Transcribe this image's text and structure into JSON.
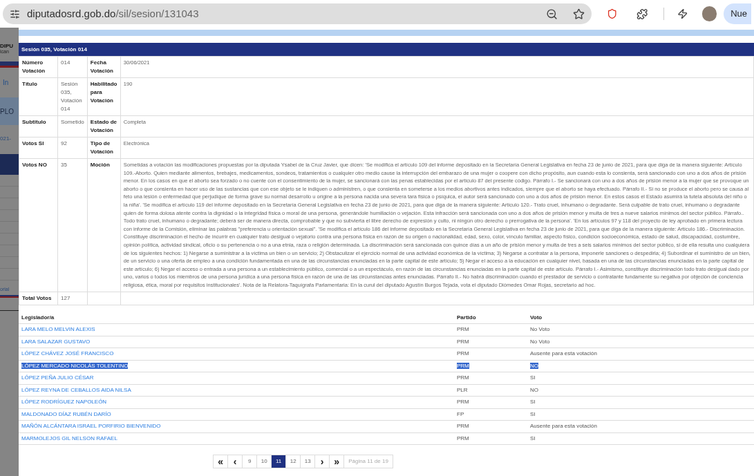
{
  "browser": {
    "url_host": "diputadosrd.gob.do",
    "url_path": "/sil/sesion/131043",
    "profile_button": "Nue"
  },
  "background_fragments": [
    "DIPU",
    "ican",
    "In",
    "PLO",
    "021-",
    "orial"
  ],
  "session": {
    "title": "Sesión 035, Votación 014",
    "rows": [
      {
        "label": "Número Votación",
        "value": "014",
        "label2": "Fecha Votación",
        "value2": "30/06/2021"
      },
      {
        "label": "Título",
        "value": "Sesión 035, Votación 014",
        "label2": "Habilitado para Votación",
        "value2": "190"
      },
      {
        "label": "Subtitulo",
        "value": "Sometido",
        "label2": "Estado de Votación",
        "value2": "Completa"
      },
      {
        "label": "Votos SI",
        "value": "92",
        "label2": "Tipo de Votación",
        "value2": "Electrónica"
      },
      {
        "label": "Votos NO",
        "value": "35",
        "label2": "Moción",
        "value2": "Sometidas a votación las modificaciones propuestas por la diputada Ysabel de la Cruz Javier, que dicen: 'Se modifica el artículo 109 del informe depositado en la Secretaría General Legislativa en fecha 23 de junio de 2021, para que diga de la manera siguiente: Artículo 109.-Aborto. Quien mediante alimentos, brebajes, medicamentos, sondeos, tratamientos o cualquier otro medio cause la interrupción del embarazo de una mujer o coopere con dicho propósito, aun cuando esta lo consienta, será sancionado con uno a dos años de prisión menor. En los casos en que el aborto sea forzado o no cuente con el consentimiento de la mujer, se sancionará con las penas establecidas por el artículo 87 del presente código. Párrafo I.- Se sancionará con uno a dos años de prisión menor a la mujer que se provoque un aborto o que consienta en hacer uso de las sustancias que con ese objeto se le indiquen o administren, o que consienta en someterse a los medios abortivos antes indicados, siempre que el aborto se haya efectuado. Párrafo II.- Si no se produce el aborto pero se causa al feto una lesión o enfermedad que perjudique de forma grave su normal desarrollo u origine a la persona nacida una severa tara física o psíquica, el autor será sancionado con uno a dos años de prisión menor. En estos casos el Estado asumirá la tutela absoluta del niño o la niña'. 'Se modifica el artículo 119 del informe depositado en la Secretaría General Legislativa en fecha 23 de junio de 2021, para que diga de la manera siguiente: Artículo 120.- Trato cruel, inhumano o degradante. Será culpable de trato cruel, inhumano o degradante quien de forma dolosa atente contra la dignidad o la integridad física o moral de una persona, generándole humillación o vejación. Esta infracción será sancionada con uno a dos años de prisión menor y multa de tres a nueve salarios mínimos del sector público. Párrafo.. Todo trato cruel, inhumano o degradante; deberá ser de manera directa, comprobable y que no subvierta el libre derecho de expresión y culto, ni ningún otro derecho o prerrogativa de la persona'. 'En los artículos 97 y 118 del proyecto de ley aprobado en primera lectura con informe de la Comisión, eliminar las palabras \"preferencia u orientación sexual\". 'Se modifica el artículo 186 del informe depositado en la Secretaría General Legislativa en fecha 23 de junio de 2021, para que diga de la manera siguiente: Artículo 186.- Discriminación. Constituye discriminación el hecho de incurrir en cualquier trato desigual o vejatorio contra una persona física en razón de su origen o nacionalidad, edad, sexo, color, vínculo familiar, aspecto físico, condición socioeconómica, estado de salud, discapacidad, costumbre, opinión política, actividad sindical, oficio o su pertenencia o no a una etnia, raza o religión determinada. La discriminación será sancionada con quince días a un año de prisión menor y multa de tres a seis salarios mínimos del sector público, si de ella resulta uno cualquiera de los siguientes hechos: 1) Negarse a suministrar a la víctima un bien o un servicio; 2) Obstaculizar el ejercicio normal de una actividad económica de la víctima; 3) Negarse a contratar a la persona, imponerle sanciones o despedirla; 4) Subordinar el suministro de un bien, de un servicio o una oferta de empleo a una condición fundamentada en una de las circunstancias enunciadas en la parte capital de este artículo; 5) Negar el acceso a la educación en cualquier nivel, basada en una de las circunstancias enunciadas en la parte capital de este artículo; 6) Negar el acceso o entrada a una persona a un establecimiento público, comercial o a un espectáculo, en razón de las circunstancias enunciadas en la parte capital de este artículo. Párrafo I.- Asimismo, constituye discriminación todo trato desigual dado por uno, varios o todos los miembros de una persona jurídica a una persona física en razón de una de las circunstancias antes enunciadas. Párrafo II.- No habrá discriminación cuando el prestador de servicio o contratante fundamente su negativa por objeción de conciencia religiosa, ética, moral por requisitos institucionales'. Nota de la Relatora-Taquígrafa Parlamentaria: En la curul del diputado Agustín Burgos Tejada, vota el diputado Diómedes Omar Rojas, secretario ad hoc."
      },
      {
        "label": "Total Votos",
        "value": "127"
      }
    ]
  },
  "votes": {
    "columns": [
      "Legislador/a",
      "Partido",
      "Voto"
    ],
    "rows": [
      {
        "name": "LARA MELO MELVIN ALEXIS",
        "party": "PRM",
        "vote": "No Voto",
        "selected": false
      },
      {
        "name": "LARA SALAZAR GUSTAVO",
        "party": "PRM",
        "vote": "No Voto",
        "selected": false
      },
      {
        "name": "LÓPEZ CHÁVEZ JOSÉ FRANCISCO",
        "party": "PRM",
        "vote": "Ausente para esta votación",
        "selected": false
      },
      {
        "name": "LÓPEZ MERCADO NICOLÁS TOLENTINO",
        "party": "PRM",
        "vote": "NO",
        "selected": true
      },
      {
        "name": "LÓPEZ PEÑA JULIO CÉSAR",
        "party": "PRM",
        "vote": "SI",
        "selected": false
      },
      {
        "name": "LÓPEZ REYNA DE CEBALLOS AIDA NILSA",
        "party": "PLR",
        "vote": "NO",
        "selected": false
      },
      {
        "name": "LÓPEZ RODRÍGUEZ NAPOLEÓN",
        "party": "PRM",
        "vote": "SI",
        "selected": false
      },
      {
        "name": "MALDONADO DÍAZ RUBÉN DARÍO",
        "party": "FP",
        "vote": "SI",
        "selected": false
      },
      {
        "name": "MAÑÓN ALCÁNTARA ISRAEL PORFIRIO BIENVENIDO",
        "party": "PRM",
        "vote": "Ausente para esta votación",
        "selected": false
      },
      {
        "name": "MARMOLEJOS GIL NELSON RAFAEL",
        "party": "PRM",
        "vote": "SI",
        "selected": false
      }
    ]
  },
  "pagination": {
    "items": [
      {
        "label": "«",
        "kind": "nav",
        "selected": false
      },
      {
        "label": "‹",
        "kind": "nav",
        "selected": false
      },
      {
        "label": "9",
        "kind": "page",
        "selected": false
      },
      {
        "label": "10",
        "kind": "page",
        "selected": false
      },
      {
        "label": "11",
        "kind": "page",
        "selected": true
      },
      {
        "label": "12",
        "kind": "page",
        "selected": false
      },
      {
        "label": "13",
        "kind": "page",
        "selected": false
      },
      {
        "label": "›",
        "kind": "nav",
        "selected": false
      },
      {
        "label": "»",
        "kind": "nav",
        "selected": false
      },
      {
        "label": "Página 11 de 19",
        "kind": "info",
        "selected": false
      }
    ]
  }
}
